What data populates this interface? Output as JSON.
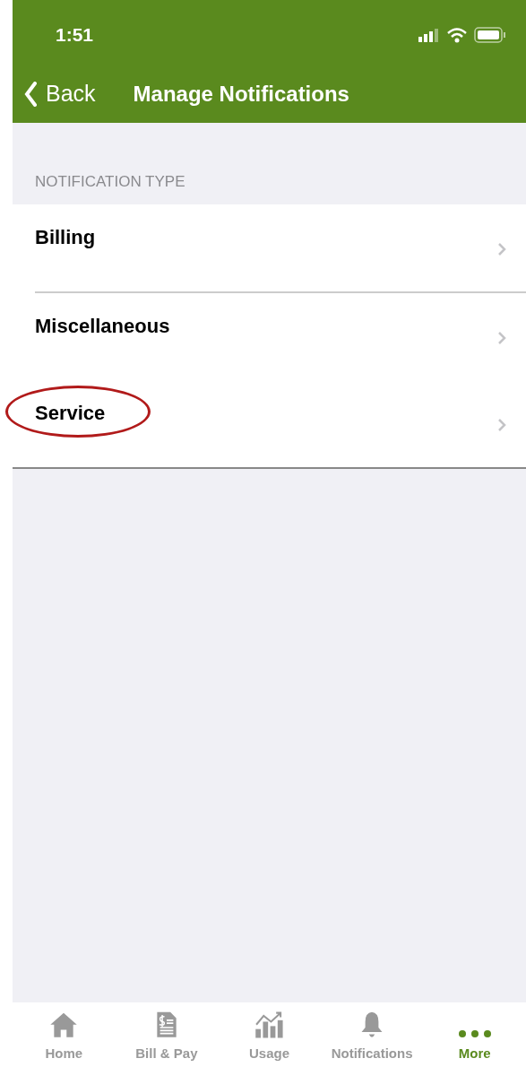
{
  "status_bar": {
    "time": "1:51"
  },
  "nav_bar": {
    "back": "Back",
    "title": "Manage Notifications"
  },
  "section": {
    "header": "NOTIFICATION TYPE",
    "items": [
      {
        "label": "Billing",
        "circled": false
      },
      {
        "label": "Miscellaneous",
        "circled": false
      },
      {
        "label": "Service",
        "circled": true
      }
    ]
  },
  "tab_bar": [
    {
      "kind": "home",
      "label": "Home",
      "selected": false
    },
    {
      "kind": "bill",
      "label": "Bill & Pay",
      "selected": false
    },
    {
      "kind": "usage",
      "label": "Usage",
      "selected": false
    },
    {
      "kind": "bell",
      "label": "Notifications",
      "selected": false
    },
    {
      "kind": "more",
      "label": "More",
      "selected": true
    }
  ]
}
